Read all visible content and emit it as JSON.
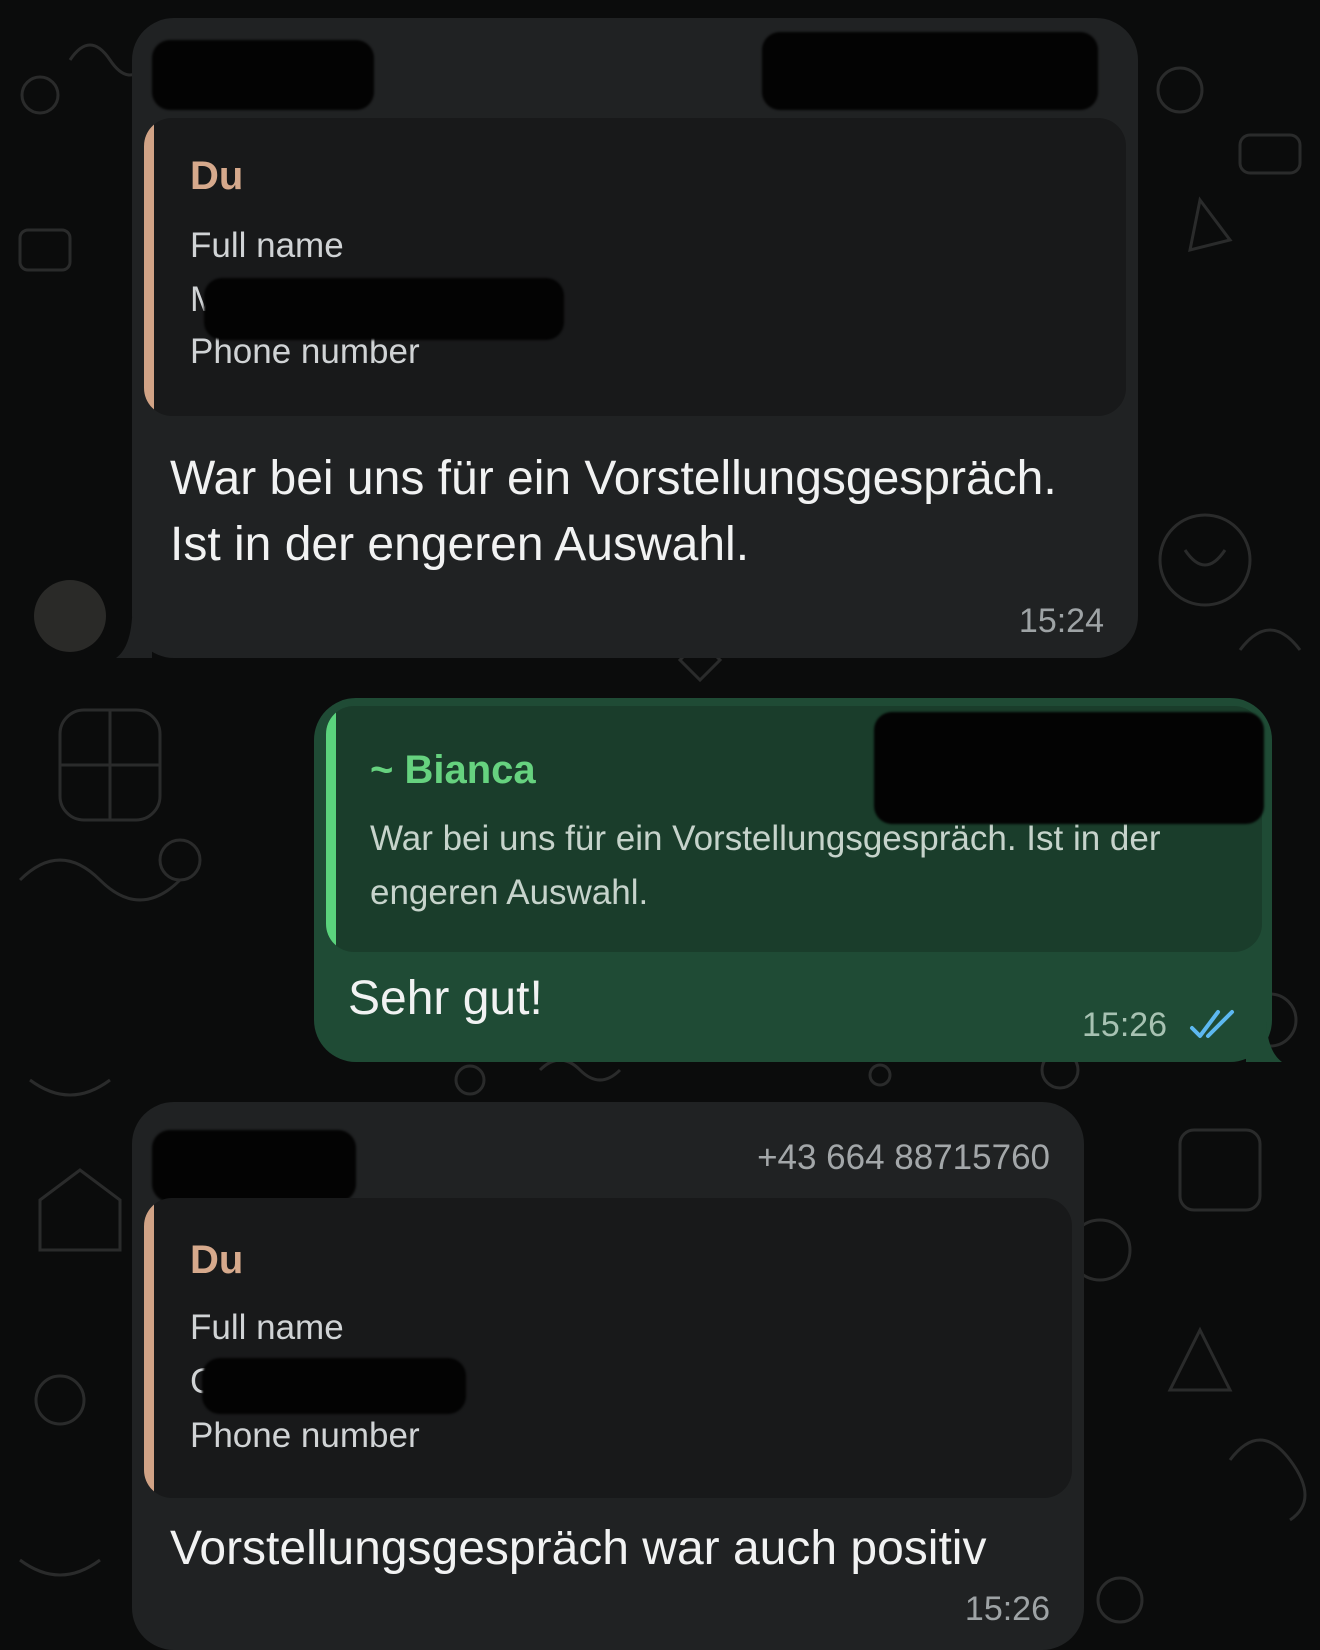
{
  "messages": [
    {
      "type": "incoming",
      "quoted": {
        "author": "Du",
        "lines": [
          "Full name",
          "M",
          "Phone number"
        ]
      },
      "text": "War bei uns für ein Vorstellungsgespräch. Ist in der engeren Auswahl.",
      "time": "15:24"
    },
    {
      "type": "outgoing",
      "quoted": {
        "author": "~ Bianca",
        "text": "War bei uns für ein Vorstellungsgespräch. Ist in der engeren Auswahl."
      },
      "text": "Sehr gut!",
      "time": "15:26",
      "status_icon": "double-check-read-icon"
    },
    {
      "type": "incoming",
      "sender_phone": "+43 664 88715760",
      "quoted": {
        "author": "Du",
        "lines": [
          "Full name",
          "C",
          "Phone number"
        ]
      },
      "text": "Vorstellungsgespräch war auch positiv",
      "time": "15:26"
    }
  ],
  "colors": {
    "incoming_bubble": "#202223",
    "outgoing_bubble": "#1f4b35",
    "quote_self_accent": "#d1a386",
    "quote_other_accent": "#5bd37d",
    "read_check": "#5db8f0"
  }
}
